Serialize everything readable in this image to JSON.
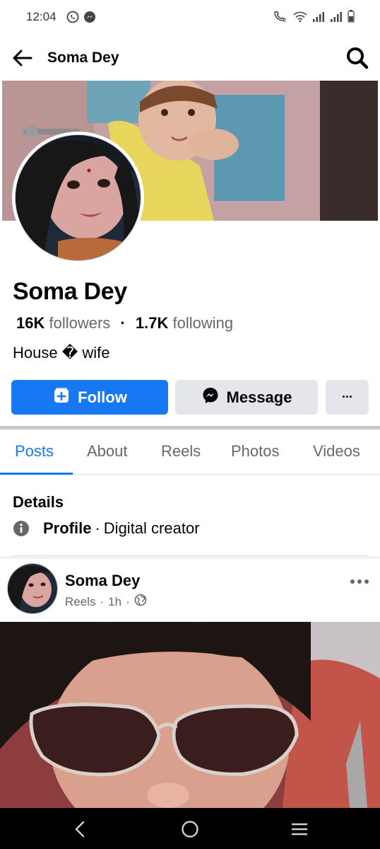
{
  "status_bar": {
    "time": "12:04",
    "left_icons": [
      "whatsapp-icon",
      "messenger-status-icon"
    ],
    "right_icons": [
      "volte-call-icon",
      "wifi-icon",
      "signal-icon",
      "signal-icon",
      "battery-icon"
    ]
  },
  "header": {
    "title": "Soma Dey",
    "back_icon": "arrow-left-icon",
    "search_icon": "search-icon"
  },
  "profile": {
    "name": "Soma Dey",
    "followers_count": "16K",
    "followers_label": "followers",
    "separator": "·",
    "following_count": "1.7K",
    "following_label": "following",
    "bio": "House � wife"
  },
  "actions": {
    "follow_label": "Follow",
    "message_label": "Message",
    "more_label": "···"
  },
  "tabs": [
    {
      "label": "Posts",
      "active": true
    },
    {
      "label": "About",
      "active": false
    },
    {
      "label": "Reels",
      "active": false
    },
    {
      "label": "Photos",
      "active": false
    },
    {
      "label": "Videos",
      "active": false
    }
  ],
  "details": {
    "title": "Details",
    "label": "Profile",
    "separator": "·",
    "value": "Digital creator"
  },
  "post": {
    "author": "Soma Dey",
    "type": "Reels",
    "dot1": "·",
    "time": "1h",
    "dot2": "·",
    "privacy_icon": "globe-icon"
  },
  "colors": {
    "accent": "#1877f2",
    "secondary_button": "#e4e6eb",
    "muted_text": "#65676b"
  }
}
